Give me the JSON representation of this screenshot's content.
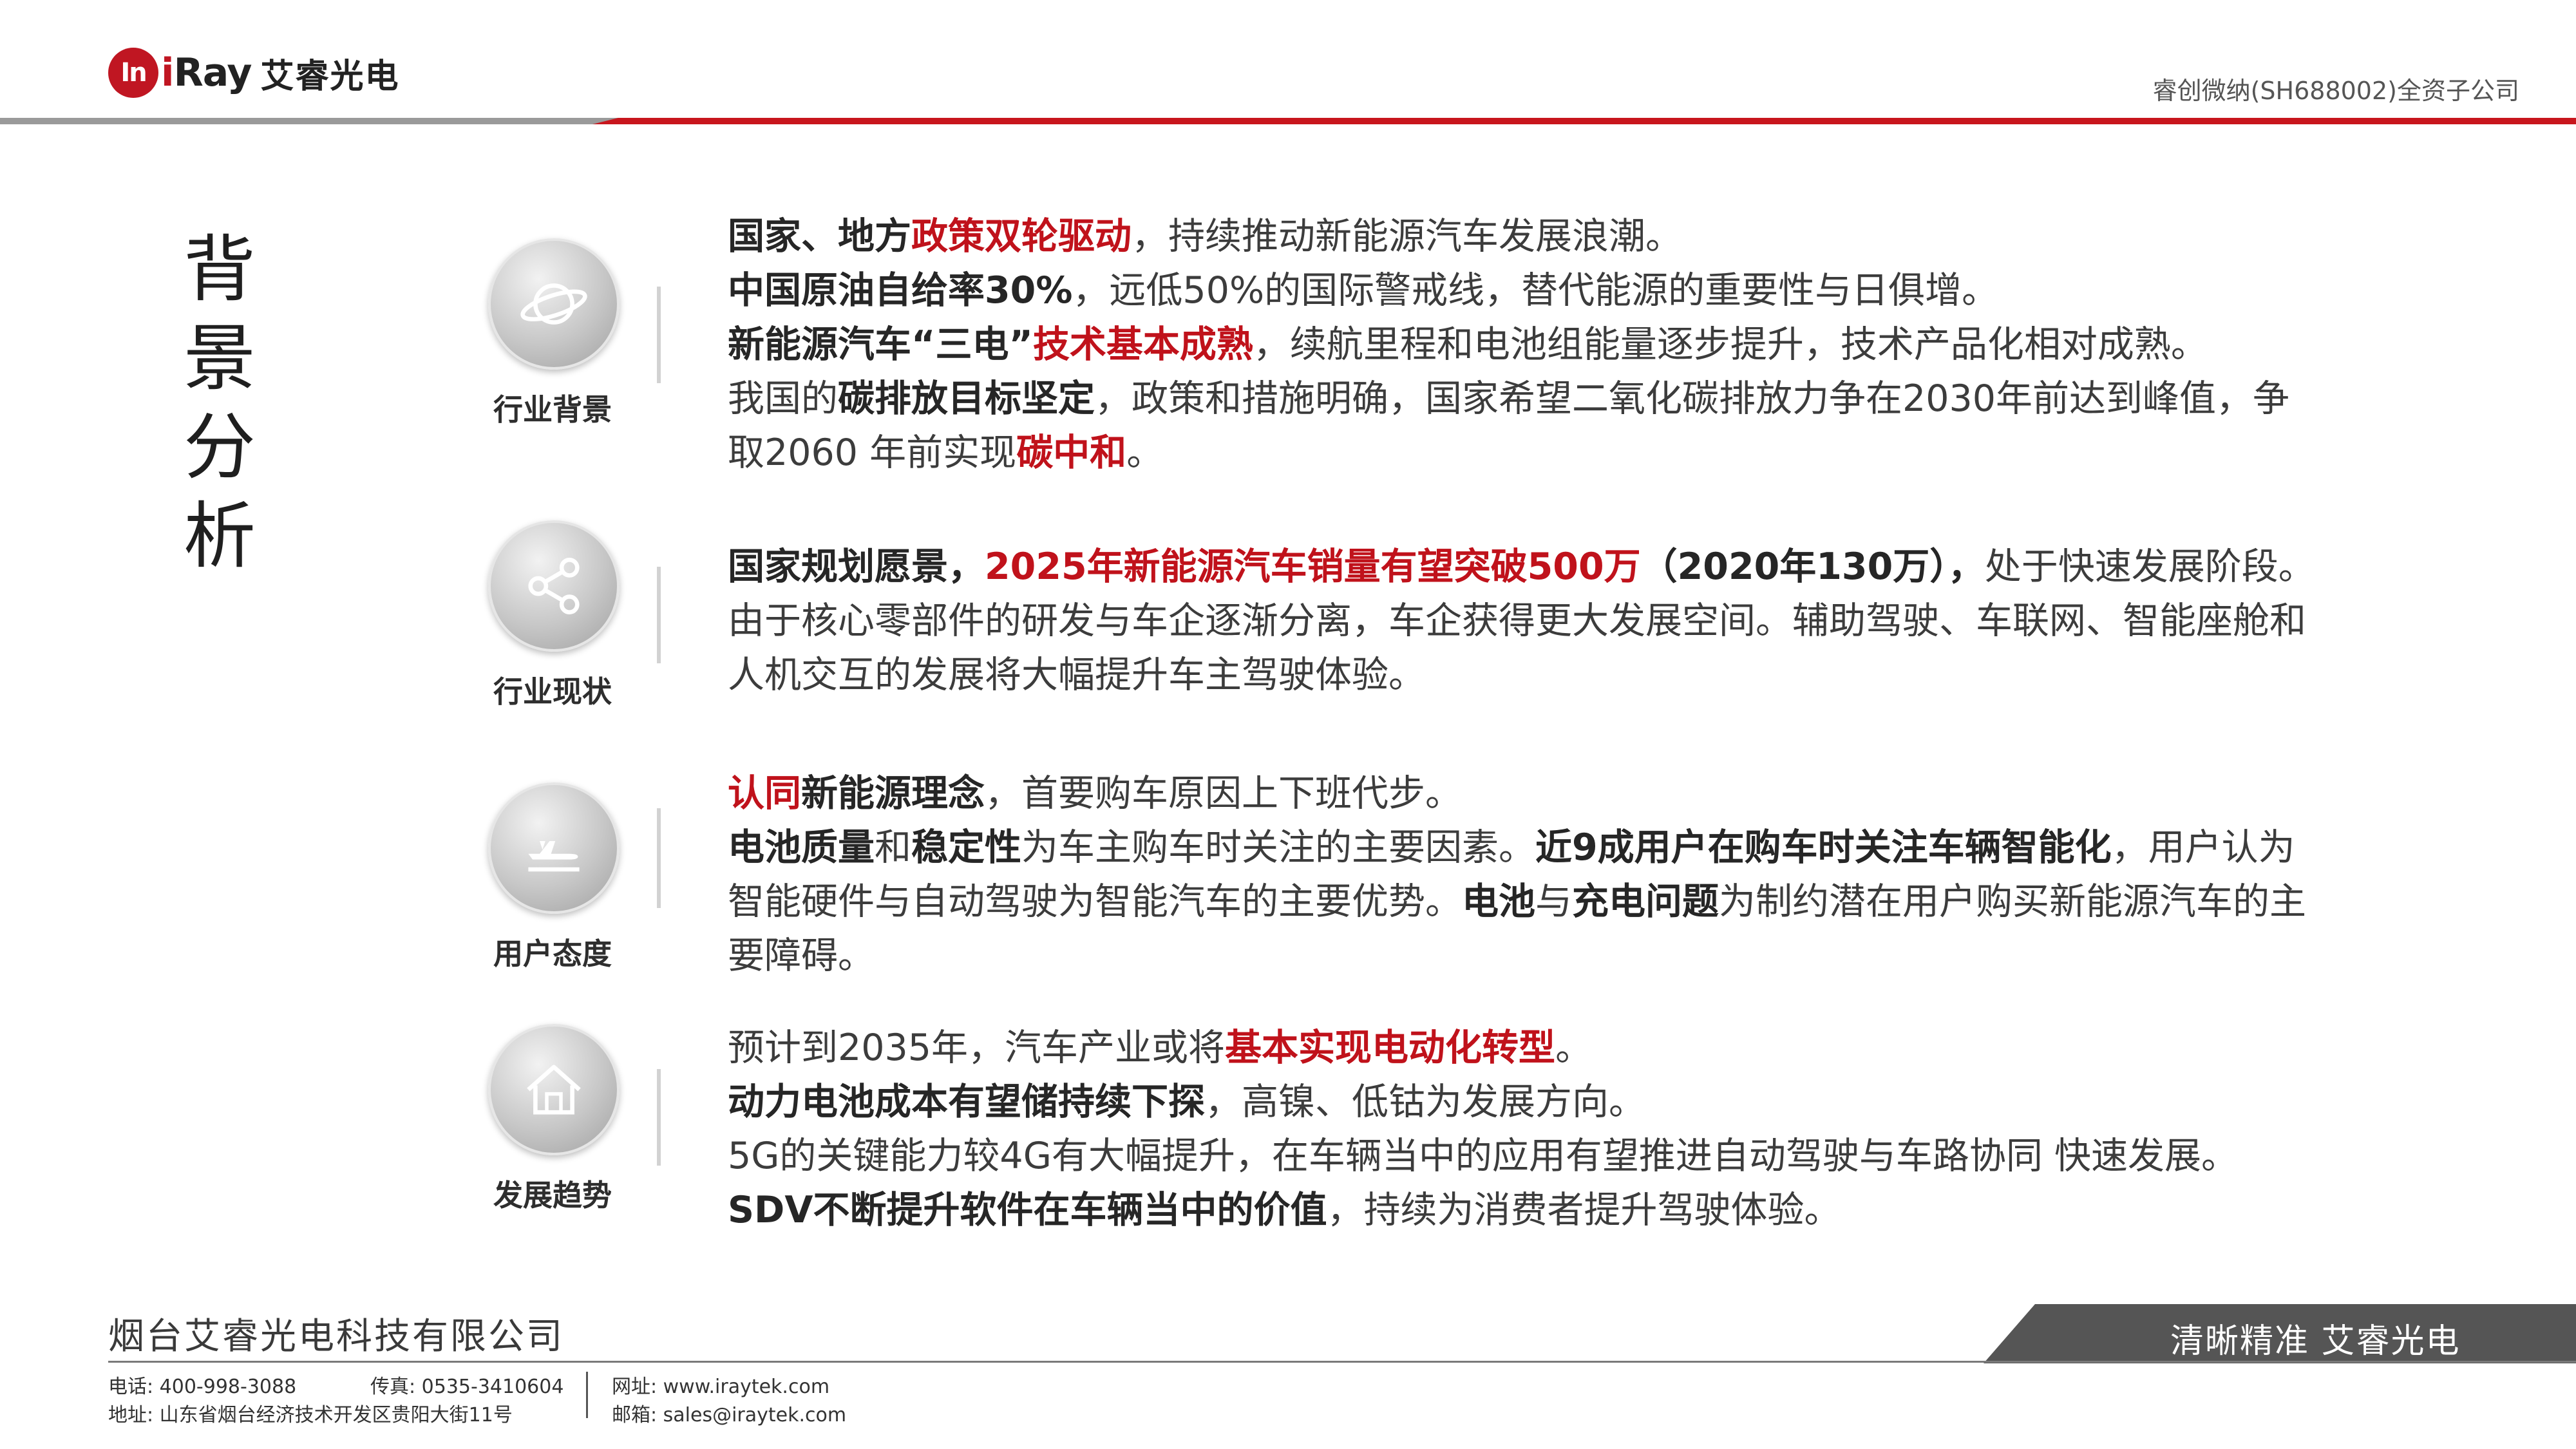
{
  "header": {
    "logo_mark": "In",
    "logo_en_prefix": "i",
    "logo_en": "Ray",
    "logo_cn": "艾睿光电",
    "subtitle": "睿创微纳(SH688002)全资子公司",
    "colors": {
      "brand_red": "#c8161d",
      "grey_rule": "#9a9a9a"
    }
  },
  "section_title": [
    "背景",
    "分析"
  ],
  "categories": [
    {
      "label": "行业背景",
      "icon": "planet-icon",
      "lines": [
        [
          {
            "t": "国家、地方",
            "s": "b"
          },
          {
            "t": "政策双轮驱动",
            "s": "r"
          },
          {
            "t": "，持续推动新能源汽车发展浪潮。",
            "s": ""
          }
        ],
        [
          {
            "t": "中国原油自给率30%",
            "s": "b"
          },
          {
            "t": "，远低50%的国际警戒线，替代能源的重要性与日俱增。",
            "s": ""
          }
        ],
        [
          {
            "t": "新能源汽车“三电”",
            "s": "b"
          },
          {
            "t": "技术基本成熟",
            "s": "r"
          },
          {
            "t": "，续航里程和电池组能量逐步提升，技术产品化相对成熟。",
            "s": ""
          }
        ],
        [
          {
            "t": "我国的",
            "s": ""
          },
          {
            "t": "碳排放目标坚定",
            "s": "b"
          },
          {
            "t": "，政策和措施明确，国家希望二氧化碳排放力争在2030年前达到峰值，争",
            "s": ""
          }
        ],
        [
          {
            "t": "取2060 年前实现",
            "s": ""
          },
          {
            "t": "碳中和",
            "s": "r"
          },
          {
            "t": "。",
            "s": ""
          }
        ]
      ]
    },
    {
      "label": "行业现状",
      "icon": "share-icon",
      "lines": [
        [
          {
            "t": "国家规划愿景，",
            "s": "b"
          },
          {
            "t": "2025年新能源汽车销量有望突破500万",
            "s": "r"
          },
          {
            "t": "（2020年130万），",
            "s": "b"
          },
          {
            "t": "处于快速发展阶段。",
            "s": ""
          }
        ],
        [
          {
            "t": "由于核心零部件的研发与车企逐渐分离，车企获得更大发展空间。辅助驾驶、车联网、智能座舱和",
            "s": ""
          }
        ],
        [
          {
            "t": "人机交互的发展将大幅提升车主驾驶体验。",
            "s": ""
          }
        ]
      ]
    },
    {
      "label": "用户态度",
      "icon": "plane-departure-icon",
      "lines": [
        [
          {
            "t": "认同",
            "s": "r"
          },
          {
            "t": "新能源理念",
            "s": "b"
          },
          {
            "t": "，首要购车原因上下班代步。",
            "s": ""
          }
        ],
        [
          {
            "t": "电池质量",
            "s": "b"
          },
          {
            "t": "和",
            "s": ""
          },
          {
            "t": "稳定性",
            "s": "b"
          },
          {
            "t": "为车主购车时关注的主要因素。",
            "s": ""
          },
          {
            "t": "近9成用户在购车时关注车辆智能化",
            "s": "b"
          },
          {
            "t": "，用户认为",
            "s": ""
          }
        ],
        [
          {
            "t": "智能硬件与自动驾驶为智能汽车的主要优势。",
            "s": ""
          },
          {
            "t": "电池",
            "s": "b"
          },
          {
            "t": "与",
            "s": ""
          },
          {
            "t": "充电问题",
            "s": "b"
          },
          {
            "t": "为制约潜在用户购买新能源汽车的主",
            "s": ""
          }
        ],
        [
          {
            "t": "要障碍。",
            "s": ""
          }
        ]
      ]
    },
    {
      "label": "发展趋势",
      "icon": "house-icon",
      "lines": [
        [
          {
            "t": "预计到2035年，汽车产业或将",
            "s": ""
          },
          {
            "t": "基本实现电动化转型",
            "s": "r"
          },
          {
            "t": "。",
            "s": ""
          }
        ],
        [
          {
            "t": "动力电池成本有望储持续下探",
            "s": "b"
          },
          {
            "t": "，高镍、低钴为发展方向。",
            "s": ""
          }
        ],
        [
          {
            "t": "5G的关键能力较4G有大幅提升，在车辆当中的应用有望推进自动驾驶与车路协同 快速发展。",
            "s": ""
          }
        ],
        [
          {
            "t": "SDV不断提升软件在车辆当中的价值",
            "s": "b"
          },
          {
            "t": "，持续为消费者提升驾驶体验。",
            "s": ""
          }
        ]
      ]
    }
  ],
  "footer": {
    "company": "烟台艾睿光电科技有限公司",
    "slogan": "清晰精准  艾睿光电",
    "phone": "电话: 400-998-3088",
    "fax": "传真: 0535-3410604",
    "website": "网址: www.iraytek.com",
    "address": "地址: 山东省烟台经济技术开发区贵阳大街11号",
    "email": "邮箱: sales@iraytek.com"
  }
}
